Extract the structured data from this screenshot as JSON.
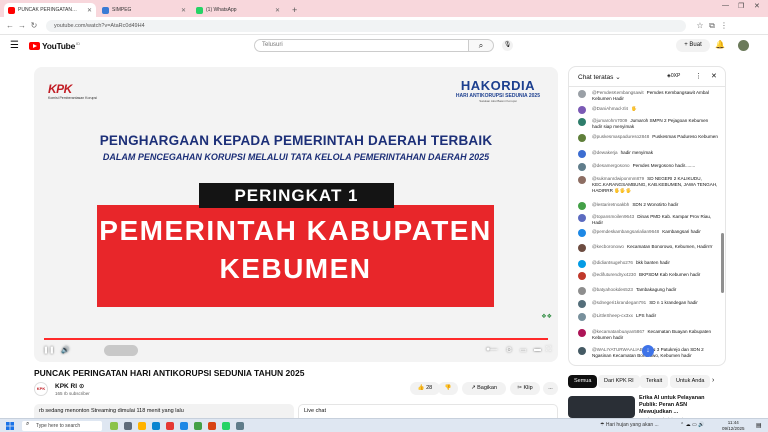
{
  "browser": {
    "tabs": [
      {
        "label": "PUNCAK PERINGATAN HARI",
        "active": true,
        "color": "#ff0000"
      },
      {
        "label": "SIMPEG",
        "active": false,
        "color": "#3a7bd5"
      },
      {
        "label": "(1) WhatsApp",
        "active": false,
        "color": "#25d366"
      }
    ],
    "url": "youtube.com/watch?v=AtaRc0d49H4"
  },
  "youtube": {
    "logo_text": "YouTube",
    "country_code": "ID",
    "search_placeholder": "Telusuri",
    "create_label": "Buat"
  },
  "video": {
    "kpk_logo": "KPK",
    "kpk_sub": "Komisi Pemberantasan Korupsi",
    "hakordia": "HAKORDIA",
    "hakordia_sub": "HARI ANTIKORUPSI SEDUNIA 2025",
    "hakordia_tag": "Satukan Aksi Basmi Korupsi",
    "award_line1": "PENGHARGAAN KEPADA PEMERINTAH DAERAH TERBAIK",
    "award_line2": "DALAM PENCEGAHAN KORUPSI MELALUI TATA KELOLA PEMERINTAHAN DAERAH 2025",
    "rank": "PERINGKAT 1",
    "name_line1": "PEMERINTAH KABUPATEN",
    "name_line2": "KEBUMEN",
    "progress": 1.0,
    "title": "PUNCAK PERINGATAN HARI ANTIKORUPSI SEDUNIA TAHUN 2025"
  },
  "channel": {
    "avatar_text": "KPK",
    "name": "KPK RI",
    "subscribers": "165 rb subscriber",
    "subscribe_label": "Subscribe",
    "likes": "28",
    "share_label": "Bagikan",
    "clip_label": "Klip",
    "more_label": "...",
    "info": "rb sedang menonton  Streaming dimulai 118 menit yang lalu",
    "livechat_label": "Live chat"
  },
  "chat": {
    "header": "Chat teratas",
    "badge": "0XP",
    "messages": [
      {
        "author": "@PemdesKembangsawit",
        "text": "Pemdes Kembangsawit Ambal Kebumen Hadir",
        "color": "#9aa0a6"
      },
      {
        "author": "@DaniAhmad-zl4",
        "text": "🖐",
        "color": "#7b5ab5"
      },
      {
        "author": "@jumarohm7009",
        "text": "Jumaroh SMPN 2 Pejagoan Kebumen hadir siap menyimak",
        "color": "#2e7d6b"
      },
      {
        "author": "@puskesmaspadureso2848",
        "text": "Puskesmas Padureso Kebumen",
        "color": "#5f7f3a"
      },
      {
        "author": "@dewakerja",
        "text": "hadir menyimak",
        "color": "#3c6dd1"
      },
      {
        "author": "@desamergosono",
        "text": "Pemdes Mergosono hadir........",
        "color": "#607d8b"
      },
      {
        "author": "@sukmanrdwiponmm879",
        "text": "SD NEGERI 2 KALIKUDU, KEC.KARANGSAMBUNG, KAB.KEBUMEN, JAWA TENGAH, HADIRRR 🖐🖐🖐",
        "color": "#8d6e63"
      },
      {
        "author": "@lestariretnoakbh",
        "text": "SDN 2 Wonotirto hadir",
        "color": "#43a047"
      },
      {
        "author": "@topansmoilen9643",
        "text": "Dinas PMD Kab. Kampar Prov Riau, Hadir",
        "color": "#5c6bc0"
      },
      {
        "author": "@pemdeskambangsarialian9648",
        "text": "Kambangsari hadir",
        "color": "#1e88e5"
      },
      {
        "author": "@kecboronowo",
        "text": "Kecamatan Bonorowo, Kebumen, Hadirrrr",
        "color": "#6d4c41"
      },
      {
        "author": "@didiantsugeho276",
        "text": "bkk banten hadir",
        "color": "#039be5"
      },
      {
        "author": "@edifuturendryx4230",
        "text": "BKPSDM Kab Kebumen hadir",
        "color": "#c0392b"
      },
      {
        "author": "@batyahookdes523",
        "text": "Tambakagung hadir",
        "color": "#8e8e8e"
      },
      {
        "author": "@sdnegeri1krandegan791",
        "text": "SD n 1 krandegan hadir",
        "color": "#546e7a"
      },
      {
        "author": "@LittleSheep-cx3xx",
        "text": "LPS hadir",
        "color": "#78909c"
      },
      {
        "author": "@kecamatanbuayan5867",
        "text": "Kecamatan Buayan Kabupaten Kebumen hadir",
        "color": "#ad1457"
      },
      {
        "author": "@WALIYATURWAALIAB",
        "text": "SDN 3 Patukrejo dan SDN 2 Ngasinan Kecamatan Bonorowo, Kebumen hadir",
        "color": "#455a64"
      }
    ]
  },
  "chips": [
    "Semua",
    "Dari KPK RI",
    "Terkait",
    "Untuk Anda"
  ],
  "recommendation": {
    "title": "Erika AI untuk Pelayanan Publik: Peran ASN Mewujudkan ...",
    "channel": "Lembaga Administrasi Negara RI"
  },
  "taskbar": {
    "search_placeholder": "Type here to search",
    "weather": "Hari hujan yang akan ...",
    "time": "11:44",
    "date": "09/12/2025"
  }
}
